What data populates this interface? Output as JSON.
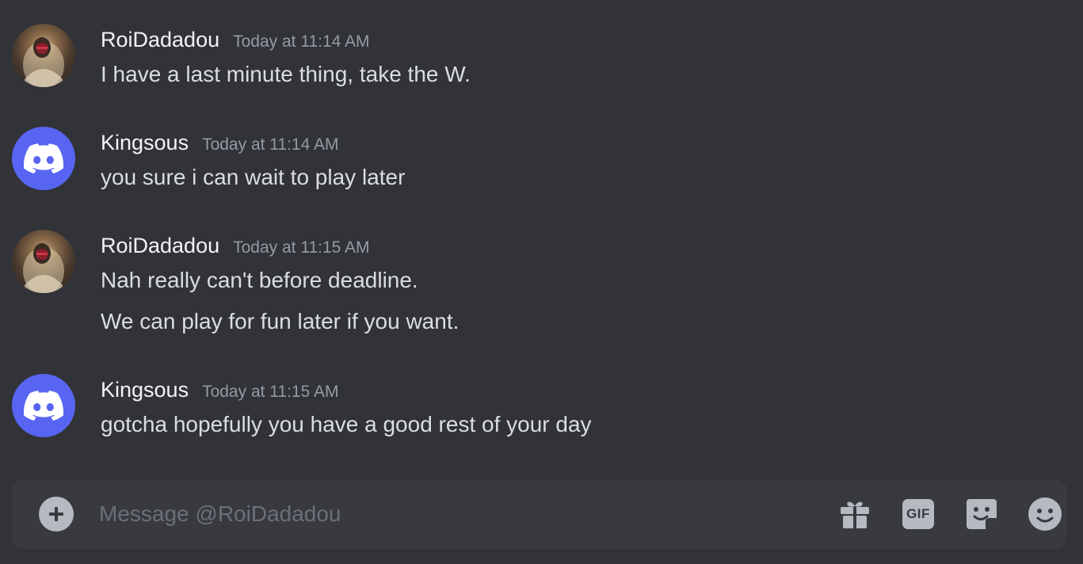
{
  "messages": [
    {
      "username": "RoiDadadou",
      "timestamp": "Today at 11:14 AM",
      "lines": [
        "I have a last minute thing, take the W."
      ],
      "avatar": "profile-art-avatar"
    },
    {
      "username": "Kingsous",
      "timestamp": "Today at 11:14 AM",
      "lines": [
        "you sure i can wait to play later"
      ],
      "avatar": "discord-logo-avatar"
    },
    {
      "username": "RoiDadadou",
      "timestamp": "Today at 11:15 AM",
      "lines": [
        "Nah really can't before deadline.",
        "We can play for fun later if you want."
      ],
      "avatar": "profile-art-avatar"
    },
    {
      "username": "Kingsous",
      "timestamp": "Today at 11:15 AM",
      "lines": [
        "gotcha hopefully you have a good rest of your day"
      ],
      "avatar": "discord-logo-avatar"
    }
  ],
  "composer": {
    "placeholder": "Message @RoiDadadou",
    "gif_label": "GIF",
    "icons": [
      "plus-circle-icon",
      "gift-icon",
      "gif-icon",
      "sticker-icon",
      "emoji-icon"
    ]
  },
  "colors": {
    "background": "#313338",
    "composer": "#383a40",
    "blurple": "#5865f2",
    "username": "#f2f3f5",
    "message": "#dbdee1",
    "timestamp": "#949ba4",
    "icon": "#b5bac1"
  }
}
